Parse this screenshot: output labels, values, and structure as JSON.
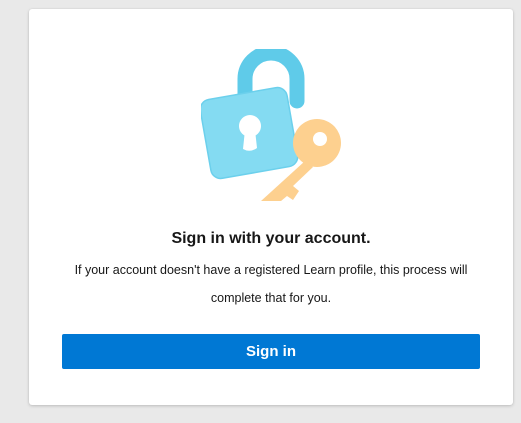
{
  "card": {
    "title": "Sign in with your account.",
    "description": "If your account doesn't have a registered Learn profile, this process will complete that for you.",
    "icons": [
      "lock-icon",
      "key-icon"
    ]
  },
  "actions": {
    "signin_label": "Sign in"
  },
  "colors": {
    "page_background": "#e9e9e9",
    "card_background": "#ffffff",
    "primary": "#0078d4",
    "lock_body": "#7fd7f0",
    "lock_shackle": "#5dc5e6",
    "key": "#fcd28f"
  }
}
